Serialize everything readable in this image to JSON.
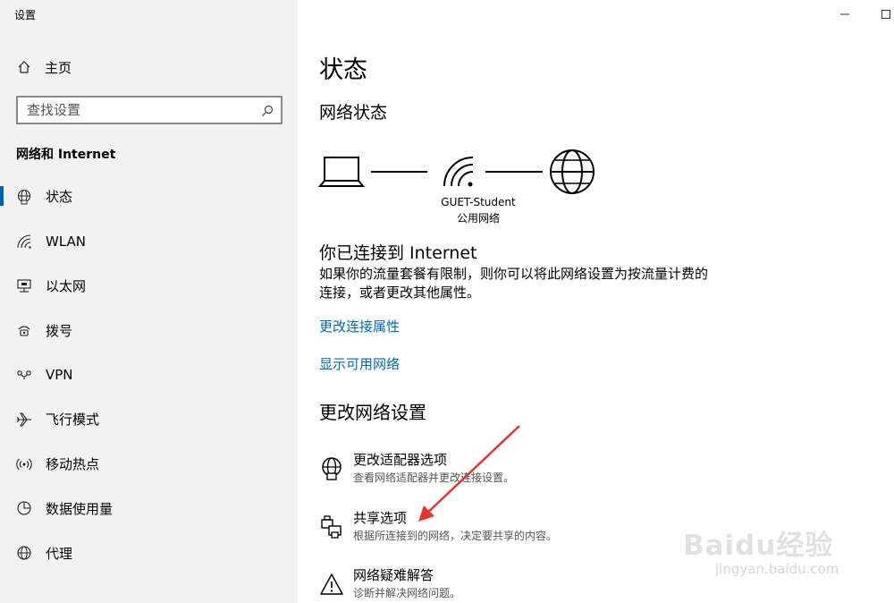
{
  "window": {
    "title": "设置",
    "minimize_icon": "minimize-icon",
    "maximize_icon": "maximize-icon"
  },
  "sidebar": {
    "home": {
      "label": "主页",
      "icon": "home-icon"
    },
    "search": {
      "placeholder": "查找设置",
      "icon": "search-icon"
    },
    "section_title": "网络和 Internet",
    "items": [
      {
        "label": "状态",
        "icon": "globe-status-icon",
        "active": true
      },
      {
        "label": "WLAN",
        "icon": "wifi-icon"
      },
      {
        "label": "以太网",
        "icon": "ethernet-icon"
      },
      {
        "label": "拨号",
        "icon": "dialup-icon"
      },
      {
        "label": "VPN",
        "icon": "vpn-icon"
      },
      {
        "label": "飞行模式",
        "icon": "airplane-icon"
      },
      {
        "label": "移动热点",
        "icon": "hotspot-icon"
      },
      {
        "label": "数据使用量",
        "icon": "data-usage-icon"
      },
      {
        "label": "代理",
        "icon": "globe-icon"
      }
    ],
    "accent_color": "#0063b1"
  },
  "main": {
    "page_title": "状态",
    "network_status_title": "网络状态",
    "network": {
      "name": "GUET-Student",
      "type": "公用网络"
    },
    "connected_title": "你已连接到 Internet",
    "connected_desc": "如果你的流量套餐有限制，则你可以将此网络设置为按流量计费的连接，或者更改其他属性。",
    "links": [
      "更改连接属性",
      "显示可用网络"
    ],
    "link_color": "#0067c0",
    "change_settings_title": "更改网络设置",
    "options": [
      {
        "title": "更改适配器选项",
        "desc": "查看网络适配器并更改连接设置。",
        "icon": "adapter-globe-icon"
      },
      {
        "title": "共享选项",
        "desc": "根据所连接到的网络，决定要共享的内容。",
        "icon": "sharing-printer-icon"
      },
      {
        "title": "网络疑难解答",
        "desc": "诊断并解决网络问题。",
        "icon": "warning-triangle-icon"
      }
    ]
  },
  "annotation": {
    "arrow_color": "#e8342f"
  },
  "watermark": {
    "brand": "Baidu经验",
    "url": "jingyan.baidu.com"
  }
}
